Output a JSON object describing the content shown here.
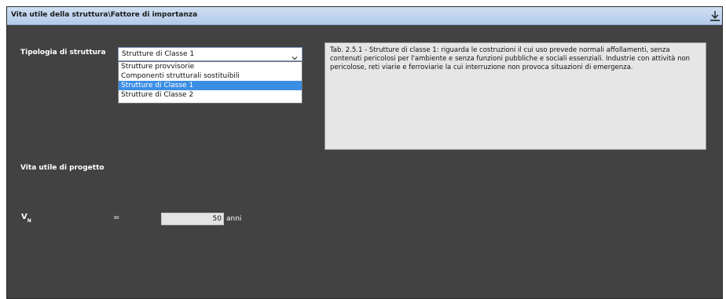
{
  "panel": {
    "title": "Vita utile della struttura\\Fattore di importanza",
    "download_icon": "download-icon"
  },
  "tipologia": {
    "label": "Tipologia di struttura",
    "selected": "Strutture di Classe 1",
    "options": [
      "Strutture provvisorie",
      "Componenti strutturali sostituibili",
      "Strutture di Classe 1",
      "Strutture di Classe 2"
    ],
    "highlighted_index": 2
  },
  "description": "Tab. 2.5.1 - Strutture di classe 1: riguarda le costruzioni il cui uso prevede normali affollamenti, senza contenuti pericolosi per l'ambiente e senza funzioni pubbliche e sociali essenziali. Industrie con attività non pericolose, reti viarie e ferroviarie la cui interruzione non provoca situazioni di emergenza.",
  "vita_utile": {
    "section_label": "Vita utile di progetto",
    "var_main": "V",
    "var_sub": "N",
    "equals": "=",
    "value": "50",
    "unit": "anni"
  }
}
